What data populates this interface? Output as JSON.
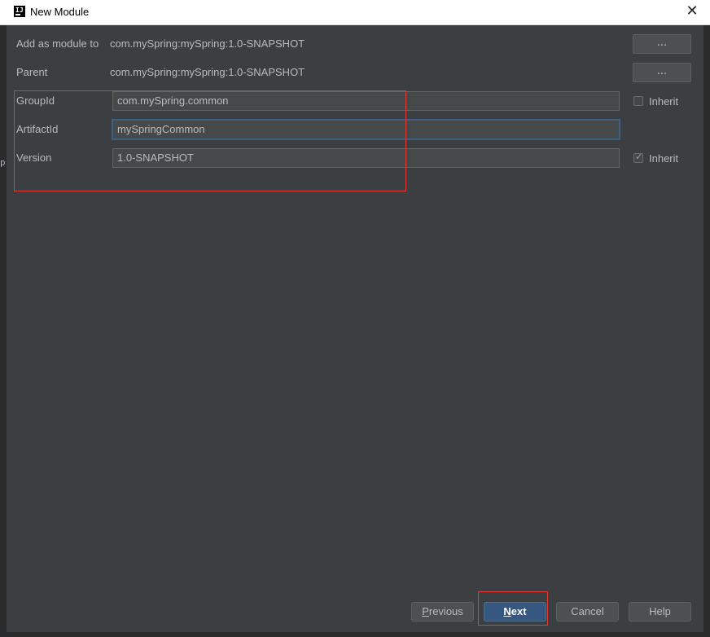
{
  "window": {
    "title": "New Module",
    "icon_label": "IJ",
    "close_glyph": "✕"
  },
  "form": {
    "add_as_module_to": {
      "label": "Add as module to",
      "value": "com.mySpring:mySpring:1.0-SNAPSHOT",
      "button": "..."
    },
    "parent": {
      "label": "Parent",
      "value": "com.mySpring:mySpring:1.0-SNAPSHOT",
      "button": "..."
    },
    "group_id": {
      "label": "GroupId",
      "value": "com.mySpring.common",
      "inherit_label": "Inherit",
      "inherit_checked": false
    },
    "artifact_id": {
      "label": "ArtifactId",
      "value": "mySpringCommon"
    },
    "version": {
      "label": "Version",
      "value": "1.0-SNAPSHOT",
      "inherit_label": "Inherit",
      "inherit_checked": true
    }
  },
  "buttons": {
    "previous": {
      "mnemonic": "P",
      "rest": "revious"
    },
    "next": {
      "mnemonic": "N",
      "rest": "ext"
    },
    "cancel": "Cancel",
    "help": "Help"
  },
  "colors": {
    "background": "#3c3f41",
    "text": "#bbbbbb",
    "annotation_red": "#e53935",
    "default_button": "#365880",
    "focus_border": "#3d6185"
  },
  "edge_text": "p"
}
